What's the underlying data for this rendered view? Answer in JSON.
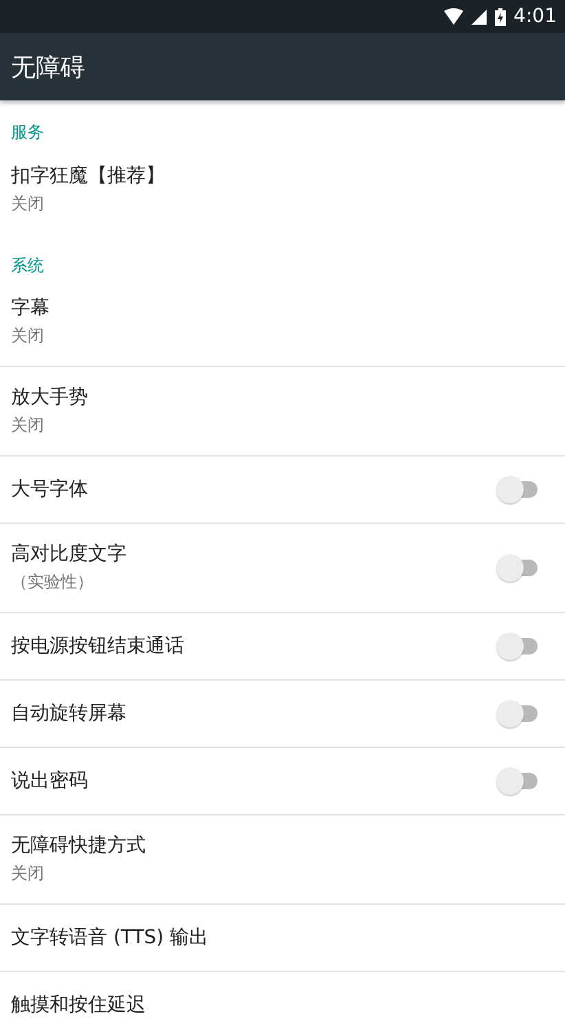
{
  "status_bar": {
    "time": "4:01"
  },
  "app_bar": {
    "title": "无障碍"
  },
  "sections": [
    {
      "header": "服务",
      "items": [
        {
          "kind": "text",
          "title": "扣字狂魔【推荐】",
          "summary": "关闭"
        }
      ]
    },
    {
      "header": "系统",
      "items": [
        {
          "kind": "text",
          "title": "字幕",
          "summary": "关闭"
        },
        {
          "kind": "text",
          "title": "放大手势",
          "summary": "关闭"
        },
        {
          "kind": "switch",
          "title": "大号字体",
          "on": false
        },
        {
          "kind": "switch",
          "title": "高对比度文字",
          "summary": "（实验性）",
          "on": false
        },
        {
          "kind": "switch",
          "title": "按电源按钮结束通话",
          "on": false
        },
        {
          "kind": "switch",
          "title": "自动旋转屏幕",
          "on": false
        },
        {
          "kind": "switch",
          "title": "说出密码",
          "on": false
        },
        {
          "kind": "text",
          "title": "无障碍快捷方式",
          "summary": "关闭"
        },
        {
          "kind": "text",
          "title": "文字转语音 (TTS) 输出"
        },
        {
          "kind": "text",
          "title": "触摸和按住延迟"
        }
      ]
    }
  ]
}
